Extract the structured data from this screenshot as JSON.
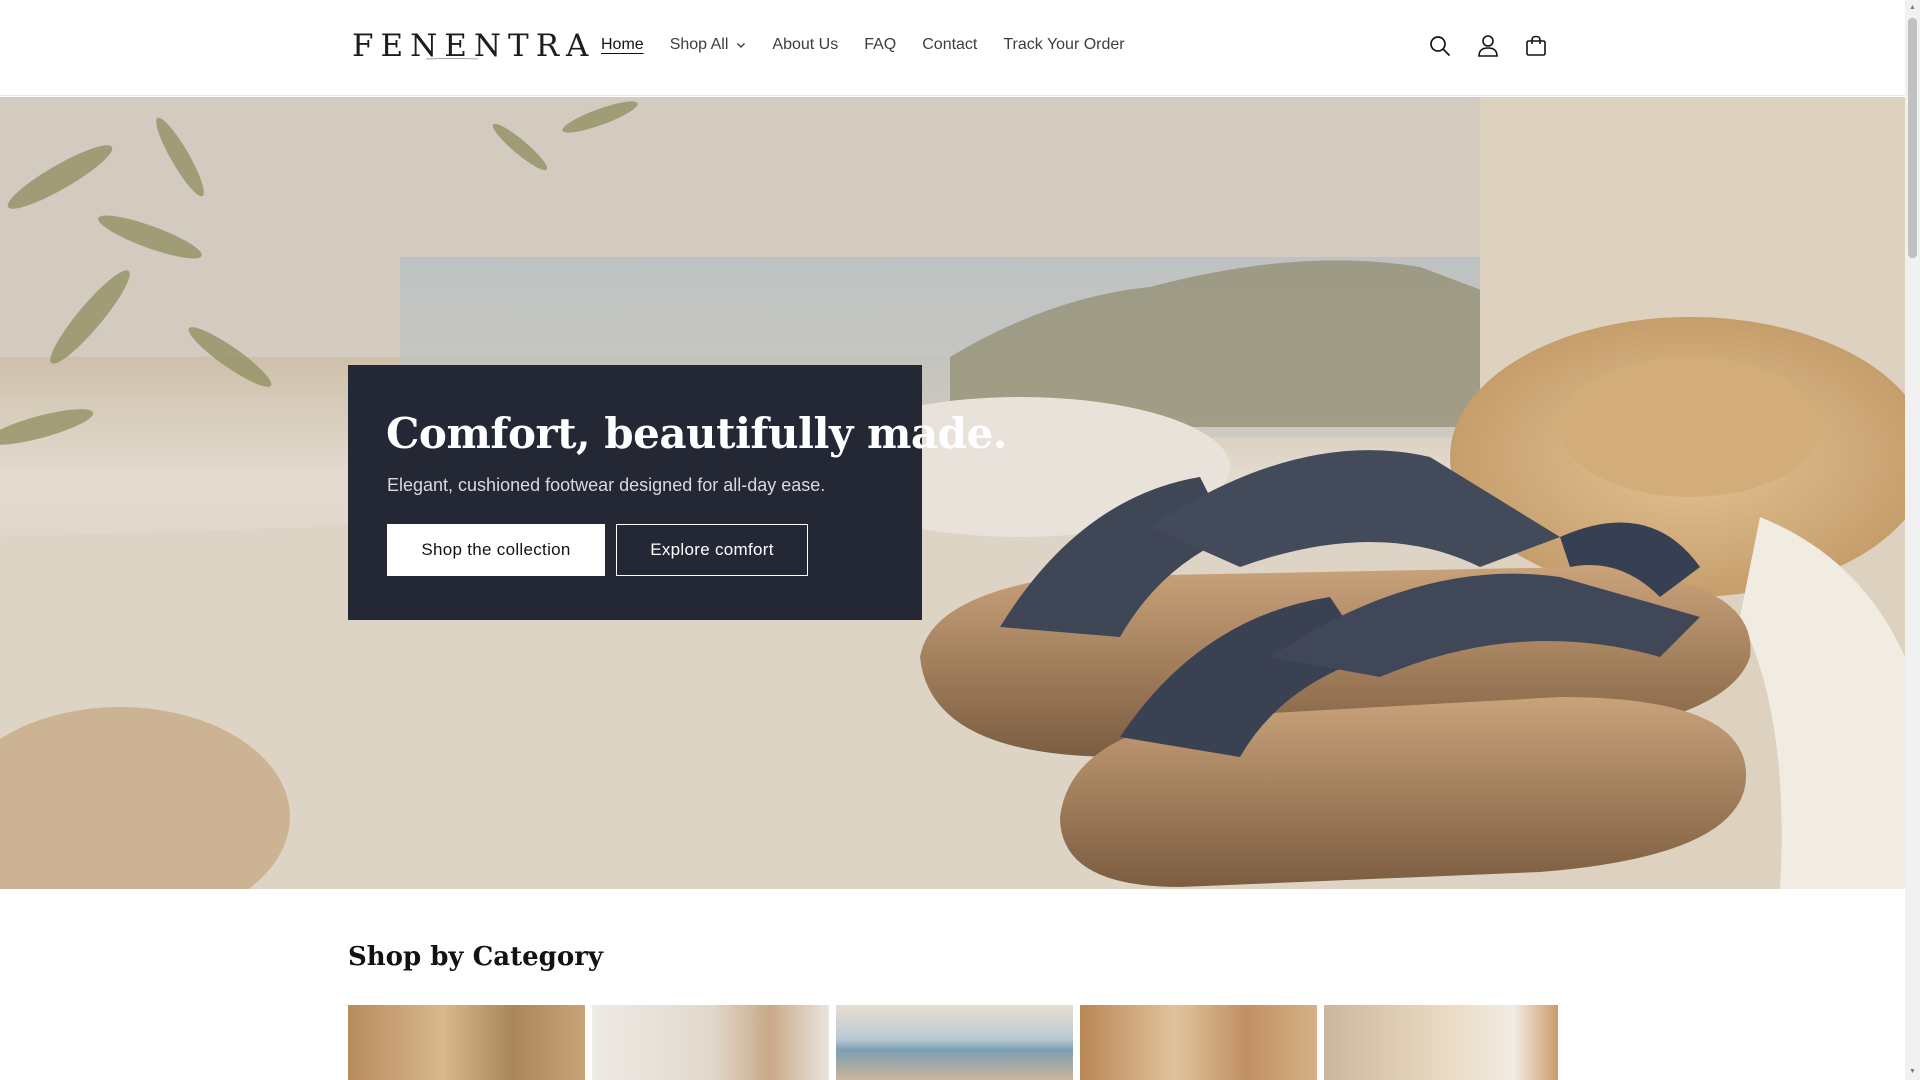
{
  "brand": {
    "name": "FENENTRA"
  },
  "nav": {
    "items": [
      {
        "label": "Home",
        "active": true
      },
      {
        "label": "Shop All",
        "has_dropdown": true
      },
      {
        "label": "About Us"
      },
      {
        "label": "FAQ"
      },
      {
        "label": "Contact"
      },
      {
        "label": "Track Your Order"
      }
    ]
  },
  "header_icons": [
    "search-icon",
    "account-icon",
    "cart-icon"
  ],
  "hero": {
    "title": "Comfort, beautifully made.",
    "subtitle": "Elegant, cushioned footwear designed for all-day ease.",
    "primary_button": "Shop the collection",
    "secondary_button": "Explore comfort"
  },
  "categories": {
    "title": "Shop by Category",
    "count_visible": 5
  },
  "colors": {
    "hero_box": "#232834",
    "text": "#121212",
    "white": "#ffffff"
  }
}
